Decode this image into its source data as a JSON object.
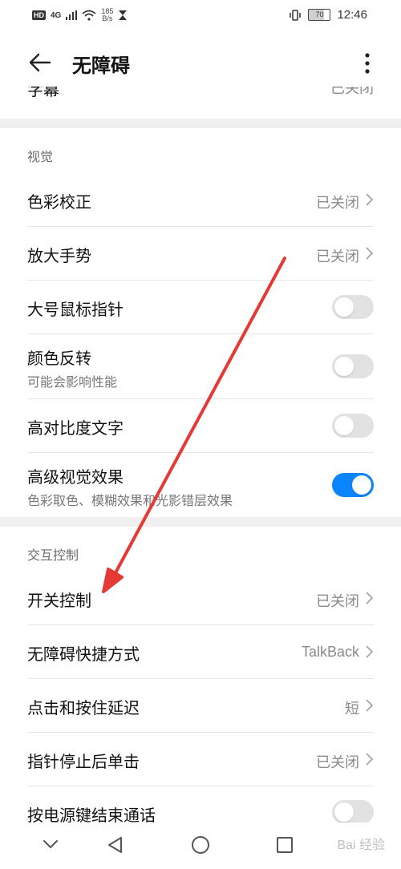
{
  "status_bar": {
    "hd": "HD",
    "net": "4G",
    "speed_value": "185",
    "speed_unit": "B/s",
    "battery": "70",
    "time": "12:46"
  },
  "header": {
    "title": "无障碍"
  },
  "clipped_row": {
    "label": "字幕",
    "value": "已关闭"
  },
  "vision": {
    "section_title": "视觉",
    "items": [
      {
        "label": "色彩校正",
        "value": "已关闭"
      },
      {
        "label": "放大手势",
        "value": "已关闭"
      },
      {
        "label": "大号鼠标指针",
        "toggle": false
      },
      {
        "label": "颜色反转",
        "sub": "可能会影响性能",
        "toggle": false
      },
      {
        "label": "高对比度文字",
        "toggle": false
      },
      {
        "label": "高级视觉效果",
        "sub": "色彩取色、模糊效果和光影错层效果",
        "toggle": true
      }
    ]
  },
  "interaction": {
    "section_title": "交互控制",
    "items": [
      {
        "label": "开关控制",
        "value": "已关闭"
      },
      {
        "label": "无障碍快捷方式",
        "value": "TalkBack"
      },
      {
        "label": "点击和按住延迟",
        "value": "短"
      },
      {
        "label": "指针停止后单击",
        "value": "已关闭"
      },
      {
        "label": "按电源键结束通话",
        "toggle": false
      }
    ]
  },
  "watermark": "Bai 经验",
  "colors": {
    "accent": "#0a84ff",
    "arrow": "#e53935"
  }
}
